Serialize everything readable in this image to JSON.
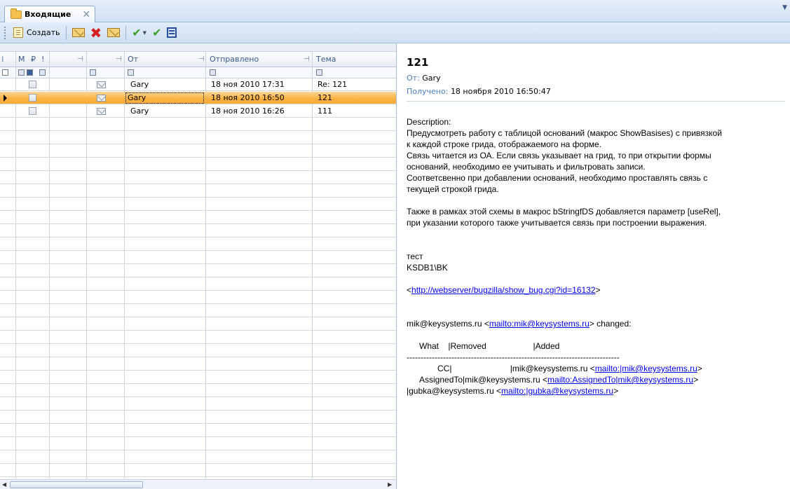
{
  "tab": {
    "label": "Входящие",
    "close": "✕",
    "dropdown": "▼"
  },
  "toolbar": {
    "create_label": "Создать"
  },
  "grid": {
    "headers": {
      "grouping": "⁞",
      "mark": "М",
      "pin": "₽",
      "importance": "!",
      "from": "От",
      "sent": "Отправлено",
      "subject": "Тема"
    },
    "rows": [
      {
        "from": "Gary",
        "sent": "18 ноя 2010 17:31",
        "subject": "Re: 121",
        "selected": false
      },
      {
        "from": "Gary",
        "sent": "18 ноя 2010 16:50",
        "subject": "121",
        "selected": true
      },
      {
        "from": "Gary",
        "sent": "18 ноя 2010 16:26",
        "subject": "111",
        "selected": false
      }
    ]
  },
  "preview": {
    "subject": "121",
    "from_label": "От:",
    "from_value": "Gary",
    "received_label": "Получено:",
    "received_value": "18 ноября 2010 16:50:47",
    "body": {
      "description_label": "Description:",
      "p1": "Предусмотреть работу с таблицой оснований (макрос ShowBasises) с привязкой",
      "p2": "к каждой строке грида, отображаемого на форме.",
      "p3": "Связь читается из ОА. Если связь указывает на грид, то при открытии формы",
      "p4": "оснований, необходимо ее учитывать и фильтровать записи.",
      "p5": "Соответсвенно при добавлении оснований, необходимо проставлять связь с",
      "p6": "текущей строкой грида.",
      "p7": "Также в рамках этой схемы в макрос bStringfDS добавляется параметр [useRel],",
      "p8": "при указании которого также учитывается связь при построении выражения.",
      "test": "тест",
      "author": "KSDB1\\BK",
      "url_open": "<",
      "url": "http://webserver/bugzilla/show_bug.cgi?id=16132",
      "url_close": ">",
      "changed_prefix": "mik@keysystems.ru <",
      "changed_link": "mailto:mik@keysystems.ru",
      "changed_suffix": "> changed:",
      "table_header": "What    |Removed                    |Added",
      "table_rule": "----------------------------------------------------------------------------",
      "cc_prefix": "CC|                         |mik@keysystems.ru <",
      "cc_link": "mailto:|mik@keysystems.ru",
      "cc_suffix": ">",
      "assigned_prefix": "AssignedTo|mik@keysystems.ru <",
      "assigned_link": "mailto:AssignedTo|mik@keysystems.ru",
      "assigned_suffix": ">",
      "gubka_prefix": "|gubka@keysystems.ru <",
      "gubka_link": "mailto:|gubka@keysystems.ru",
      "gubka_suffix": ">"
    }
  },
  "colors": {
    "selection": "#fbb344",
    "label_blue": "#4a7fbf",
    "link": "#0000ee"
  }
}
